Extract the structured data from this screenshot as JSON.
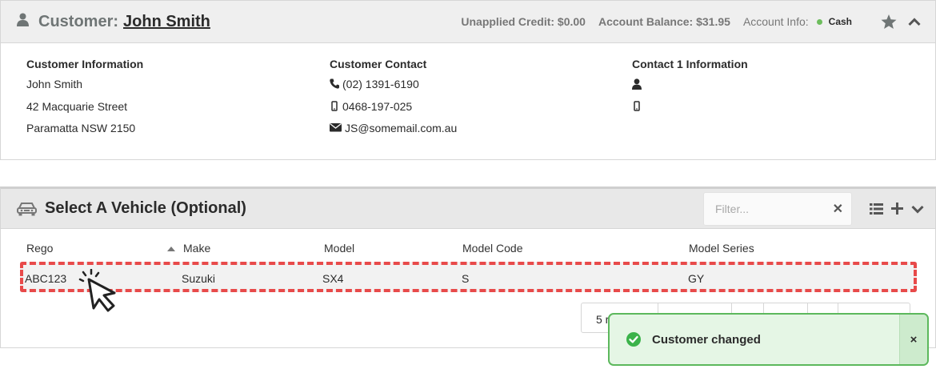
{
  "customer": {
    "label": "Customer:",
    "name": "John Smith",
    "unapplied_credit": "Unapplied Credit: $0.00",
    "account_balance": "Account Balance: $31.95",
    "account_info_label": "Account Info:",
    "account_type": "Cash",
    "status_color": "#6dbd5d",
    "info": {
      "heading": "Customer Information",
      "lines": [
        "John Smith",
        "42 Macquarie Street",
        "Paramatta NSW 2150"
      ]
    },
    "contact": {
      "heading": "Customer Contact",
      "phone": "(02) 1391-6190",
      "mobile": "0468-197-025",
      "email": "JS@somemail.com.au"
    },
    "contact1": {
      "heading": "Contact 1 Information"
    }
  },
  "vehicle": {
    "title": "Select A Vehicle (Optional)",
    "filter_placeholder": "Filter...",
    "columns": [
      "Rego",
      "Make",
      "Model",
      "Model Code",
      "Model Series"
    ],
    "rows": [
      {
        "rego": "ABC123",
        "make": "Suzuki",
        "model": "SX4",
        "model_code": "S",
        "model_series": "GY"
      }
    ],
    "page_size": "5 r",
    "highlight_color": "#e84a4a"
  },
  "toast": {
    "message": "Customer changed",
    "close": "×",
    "color": "#5cb85c"
  }
}
